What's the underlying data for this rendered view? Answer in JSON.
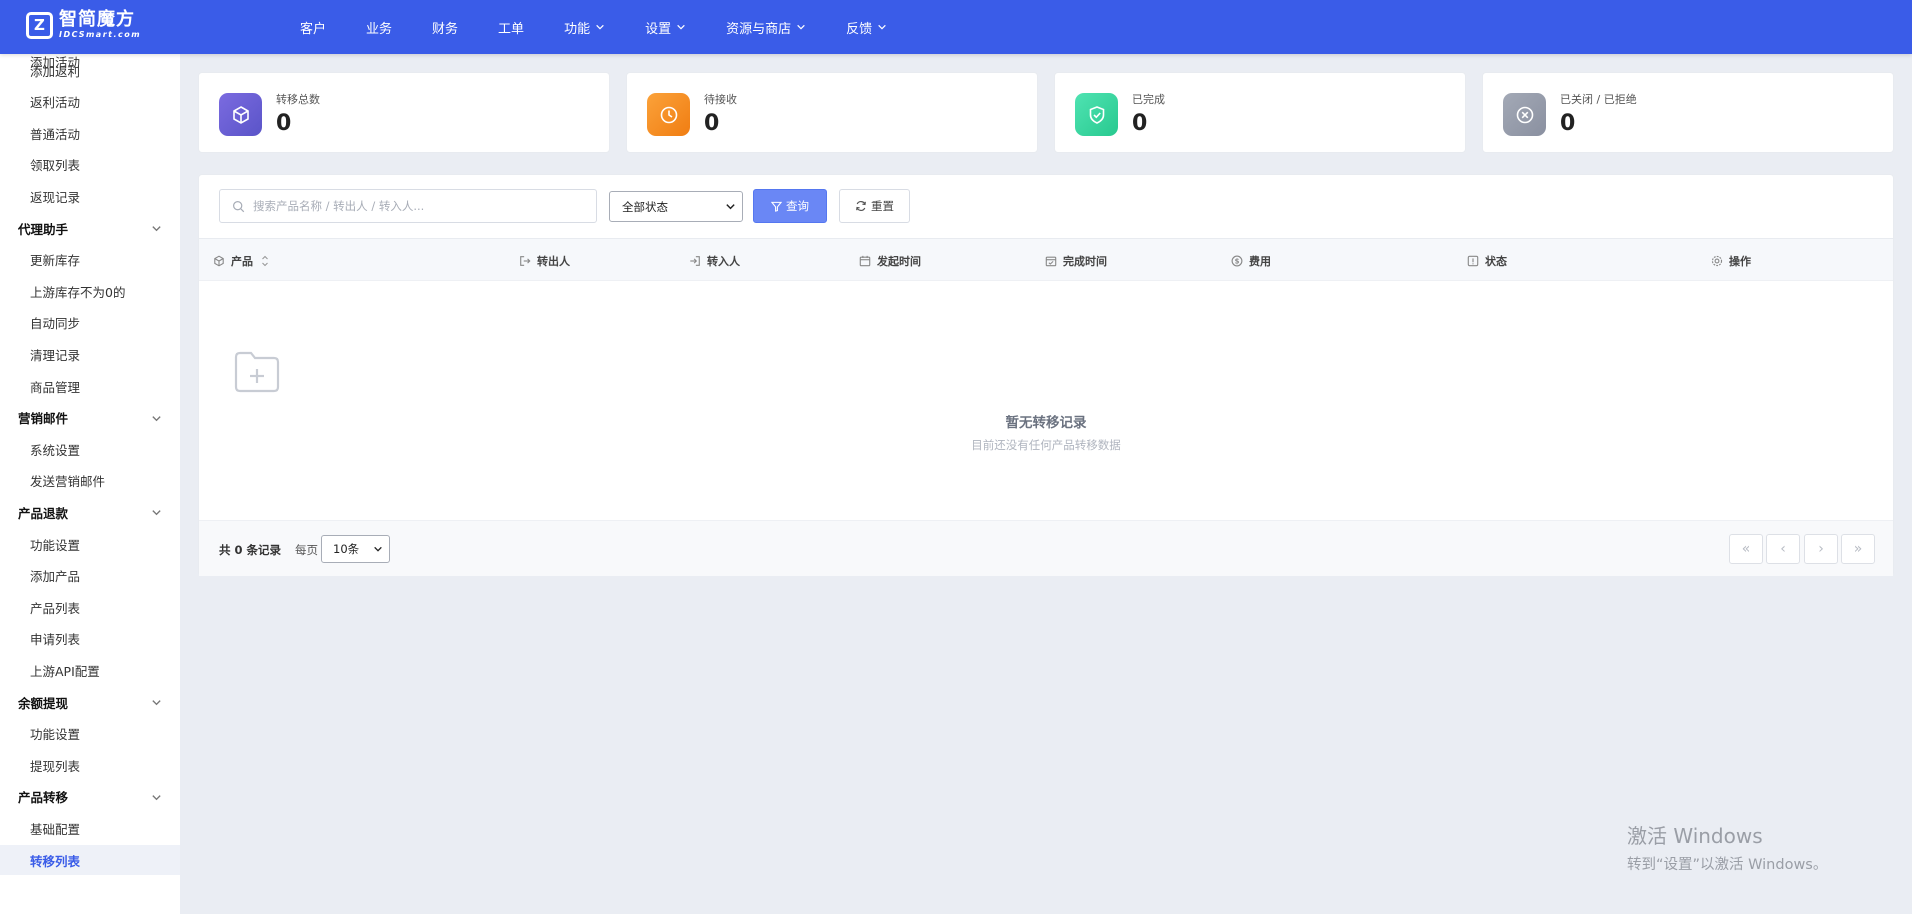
{
  "brand": {
    "logo_mark": "Z",
    "name_cn": "智简魔方",
    "name_en": "IDCSmart.com"
  },
  "nav": {
    "items": [
      {
        "label": "客户",
        "dropdown": false
      },
      {
        "label": "业务",
        "dropdown": false
      },
      {
        "label": "财务",
        "dropdown": false
      },
      {
        "label": "工单",
        "dropdown": false
      },
      {
        "label": "功能",
        "dropdown": true
      },
      {
        "label": "设置",
        "dropdown": true
      },
      {
        "label": "资源与商店",
        "dropdown": true
      },
      {
        "label": "反馈",
        "dropdown": true
      }
    ]
  },
  "sidebar": {
    "partial_top": "添加活动",
    "items": [
      {
        "label": "添加返利",
        "type": "item"
      },
      {
        "label": "返利活动",
        "type": "item"
      },
      {
        "label": "普通活动",
        "type": "item"
      },
      {
        "label": "领取列表",
        "type": "item"
      },
      {
        "label": "返现记录",
        "type": "item"
      },
      {
        "label": "代理助手",
        "type": "group"
      },
      {
        "label": "更新库存",
        "type": "item"
      },
      {
        "label": "上游库存不为0的",
        "type": "item"
      },
      {
        "label": "自动同步",
        "type": "item"
      },
      {
        "label": "清理记录",
        "type": "item"
      },
      {
        "label": "商品管理",
        "type": "item"
      },
      {
        "label": "营销邮件",
        "type": "group"
      },
      {
        "label": "系统设置",
        "type": "item"
      },
      {
        "label": "发送营销邮件",
        "type": "item"
      },
      {
        "label": "产品退款",
        "type": "group"
      },
      {
        "label": "功能设置",
        "type": "item"
      },
      {
        "label": "添加产品",
        "type": "item"
      },
      {
        "label": "产品列表",
        "type": "item"
      },
      {
        "label": "申请列表",
        "type": "item"
      },
      {
        "label": "上游API配置",
        "type": "item"
      },
      {
        "label": "余额提现",
        "type": "group"
      },
      {
        "label": "功能设置",
        "type": "item"
      },
      {
        "label": "提现列表",
        "type": "item"
      },
      {
        "label": "产品转移",
        "type": "group"
      },
      {
        "label": "基础配置",
        "type": "item"
      },
      {
        "label": "转移列表",
        "type": "item",
        "active": true
      }
    ]
  },
  "stats": [
    {
      "label": "转移总数",
      "value": "0",
      "icon": "cube-icon",
      "color_from": "#7b6be0",
      "color_to": "#5a54c8"
    },
    {
      "label": "待接收",
      "value": "0",
      "icon": "clock-icon",
      "color_from": "#fba23a",
      "color_to": "#f07d12"
    },
    {
      "label": "已完成",
      "value": "0",
      "icon": "shield-check-icon",
      "color_from": "#4fe3b2",
      "color_to": "#28c98f"
    },
    {
      "label": "已关闭 / 已拒绝",
      "value": "0",
      "icon": "close-circle-icon",
      "color_from": "#a3a9b6",
      "color_to": "#8a90a0"
    }
  ],
  "filters": {
    "search_placeholder": "搜索产品名称 / 转出人 / 转入人...",
    "status_value": "全部状态",
    "query_label": "查询",
    "reset_label": "重置"
  },
  "table": {
    "columns": [
      {
        "label": "产品",
        "icon": "cube-icon",
        "sortable": true
      },
      {
        "label": "转出人",
        "icon": "logout-icon"
      },
      {
        "label": "转入人",
        "icon": "login-icon"
      },
      {
        "label": "发起时间",
        "icon": "calendar-icon"
      },
      {
        "label": "完成时间",
        "icon": "calendar-check-icon"
      },
      {
        "label": "费用",
        "icon": "dollar-icon"
      },
      {
        "label": "状态",
        "icon": "info-icon"
      },
      {
        "label": "操作",
        "icon": "gear-icon"
      }
    ],
    "rows": [],
    "empty_title": "暂无转移记录",
    "empty_subtitle": "目前还没有任何产品转移数据"
  },
  "pagination": {
    "total_label": "共 0 条记录",
    "per_page_label": "每页",
    "per_page_value": "10条",
    "buttons": [
      "«",
      "‹",
      "›",
      "»"
    ]
  },
  "watermark": {
    "line1": "激活 Windows",
    "line2": "转到“设置”以激活 Windows。"
  },
  "colors": {
    "topbar": "#3a5ce8",
    "accent": "#3a5ce8",
    "query_button": "#6a87f5"
  }
}
